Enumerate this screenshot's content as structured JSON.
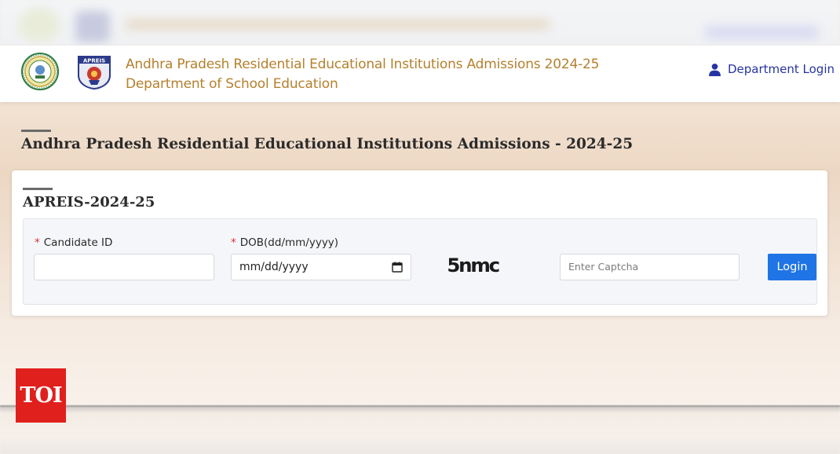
{
  "header": {
    "title_line1": "Andhra Pradesh Residential Educational Institutions Admissions 2024-25",
    "title_line2": "Department of School Education",
    "department_login": "Department Login",
    "title_color": "#b5802d",
    "link_color": "#2634a3"
  },
  "page": {
    "heading": "Andhra Pradesh Residential Educational Institutions Admissions - 2024-25"
  },
  "card": {
    "title": "APREIS-2024-25",
    "form": {
      "candidate_id_label": "Candidate ID",
      "candidate_id_value": "",
      "dob_label": "DOB(dd/mm/yyyy)",
      "dob_value": "mm/dd/yyyy",
      "required_marker": "*",
      "captcha_text": "5nmc",
      "captcha_placeholder": "Enter Captcha",
      "login_label": "Login",
      "login_color": "#1f74e6"
    }
  },
  "logos": {
    "apreis_text": "APREIS"
  },
  "watermark": {
    "text": "TOI",
    "color": "#e0201d"
  },
  "icons": {
    "user": "user-icon",
    "calendar": "calendar-icon"
  }
}
